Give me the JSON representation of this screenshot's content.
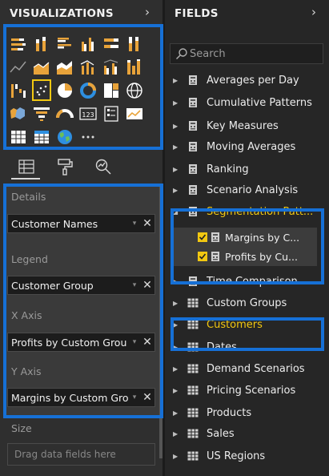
{
  "visualizations": {
    "title": "VISUALIZATIONS",
    "icons": [
      "stacked-bar-chart-icon",
      "stacked-column-chart-icon",
      "clustered-bar-chart-icon",
      "clustered-column-chart-icon",
      "100-stacked-bar-chart-icon",
      "100-stacked-column-chart-icon",
      "line-chart-icon",
      "area-chart-icon",
      "stacked-area-chart-icon",
      "line-and-column-chart-icon",
      "line-and-clustered-column-chart-icon",
      "ribbon-chart-icon",
      "waterfall-chart-icon",
      "scatter-chart-icon",
      "pie-chart-icon",
      "donut-chart-icon",
      "treemap-icon",
      "map-icon",
      "filled-map-icon",
      "funnel-chart-icon",
      "gauge-icon",
      "card-icon",
      "multi-row-card-icon",
      "kpi-icon",
      "table-icon",
      "matrix-icon",
      "globe-icon",
      "more-visuals-icon"
    ],
    "selected_icon_index": 13,
    "tabs": [
      "fields-tab-icon",
      "format-paint-roller-icon",
      "analytics-magnifier-icon"
    ],
    "wells": [
      {
        "label": "Details",
        "value": "Customer Names"
      },
      {
        "label": "Legend",
        "value": "Customer Group"
      },
      {
        "label": "X Axis",
        "value": "Profits by Custom Grou"
      },
      {
        "label": "Y Axis",
        "value": "Margins by Custom Gro"
      }
    ],
    "size": {
      "label": "Size",
      "placeholder": "Drag data fields here"
    }
  },
  "fields": {
    "title": "FIELDS",
    "search_placeholder": "Search",
    "items": [
      {
        "label": "Averages per Day",
        "kind": "measure-table"
      },
      {
        "label": "Cumulative Patterns",
        "kind": "measure-table"
      },
      {
        "label": "Key Measures",
        "kind": "measure-table"
      },
      {
        "label": "Moving Averages",
        "kind": "measure-table"
      },
      {
        "label": "Ranking",
        "kind": "measure-table"
      },
      {
        "label": "Scenario Analysis",
        "kind": "measure-table"
      },
      {
        "label": "Segmentation Patt...",
        "kind": "measure-table",
        "expanded": true,
        "selected": true
      },
      {
        "label": "Margins by C...",
        "kind": "measure",
        "child": true,
        "checked": true
      },
      {
        "label": "Profits by Cu...",
        "kind": "measure",
        "child": true,
        "checked": true
      },
      {
        "label": "Time Comparison",
        "kind": "measure-table"
      },
      {
        "label": "Custom Groups",
        "kind": "table"
      },
      {
        "label": "Customers",
        "kind": "table",
        "selected": true
      },
      {
        "label": "Dates",
        "kind": "table"
      },
      {
        "label": "Demand Scenarios",
        "kind": "table"
      },
      {
        "label": "Pricing Scenarios",
        "kind": "table"
      },
      {
        "label": "Products",
        "kind": "table"
      },
      {
        "label": "Sales",
        "kind": "table"
      },
      {
        "label": "US Regions",
        "kind": "table"
      }
    ]
  },
  "colors": {
    "highlight": "#1670d6",
    "accent": "#f2c811"
  }
}
